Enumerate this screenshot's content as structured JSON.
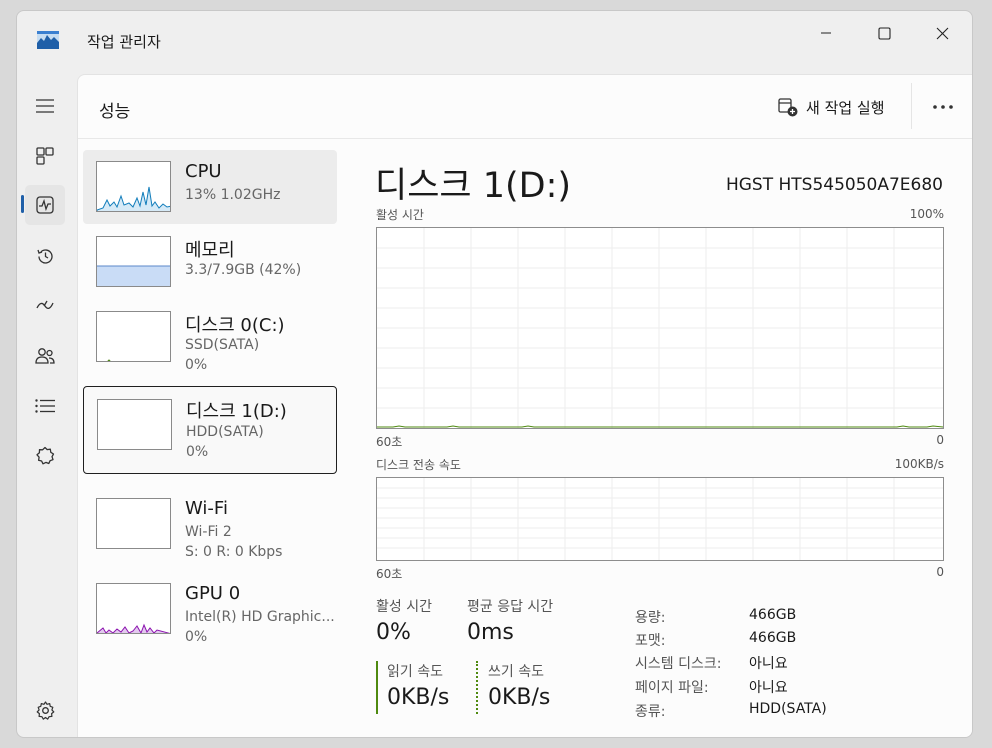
{
  "window": {
    "title": "작업 관리자"
  },
  "header": {
    "title": "성능",
    "run_task": "새 작업 실행"
  },
  "nav": [
    "menu-icon",
    "processes-icon",
    "performance-icon",
    "app-history-icon",
    "startup-apps-icon",
    "users-icon",
    "details-icon",
    "services-icon",
    "settings-icon"
  ],
  "devices": [
    {
      "name": "CPU",
      "line1": "13% 1.02GHz",
      "line2": ""
    },
    {
      "name": "메모리",
      "line1": "3.3/7.9GB (42%)",
      "line2": ""
    },
    {
      "name": "디스크 0(C:)",
      "line1": "SSD(SATA)",
      "line2": "0%"
    },
    {
      "name": "디스크 1(D:)",
      "line1": "HDD(SATA)",
      "line2": "0%"
    },
    {
      "name": "Wi-Fi",
      "line1": "Wi-Fi 2",
      "line2": "S: 0 R: 0 Kbps"
    },
    {
      "name": "GPU 0",
      "line1": "Intel(R) HD Graphic...",
      "line2": "0%"
    }
  ],
  "detail": {
    "title": "디스크 1(D:)",
    "model": "HGST HTS545050A7E680",
    "graph1": {
      "label": "활성 시간",
      "max": "100%",
      "xleft": "60초",
      "xright": "0"
    },
    "graph2": {
      "label": "디스크 전송 속도",
      "max": "100KB/s",
      "xleft": "60초",
      "xright": "0"
    },
    "stats": {
      "active_label": "활성 시간",
      "active_value": "0%",
      "response_label": "평균 응답 시간",
      "response_value": "0ms",
      "read_label": "읽기 속도",
      "read_value": "0KB/s",
      "write_label": "쓰기 속도",
      "write_value": "0KB/s"
    },
    "props": [
      {
        "label": "용량:",
        "value": "466GB"
      },
      {
        "label": "포맷:",
        "value": "466GB"
      },
      {
        "label": "시스템 디스크:",
        "value": "아니요"
      },
      {
        "label": "페이지 파일:",
        "value": "아니요"
      },
      {
        "label": "종류:",
        "value": "HDD(SATA)"
      }
    ]
  },
  "colors": {
    "accent": "#1f5fa8",
    "disk_graph": "#4f8a10",
    "cpu_graph": "#117dbb",
    "memory_graph": "#8b12ae",
    "gpu_graph": "#8b12ae"
  }
}
